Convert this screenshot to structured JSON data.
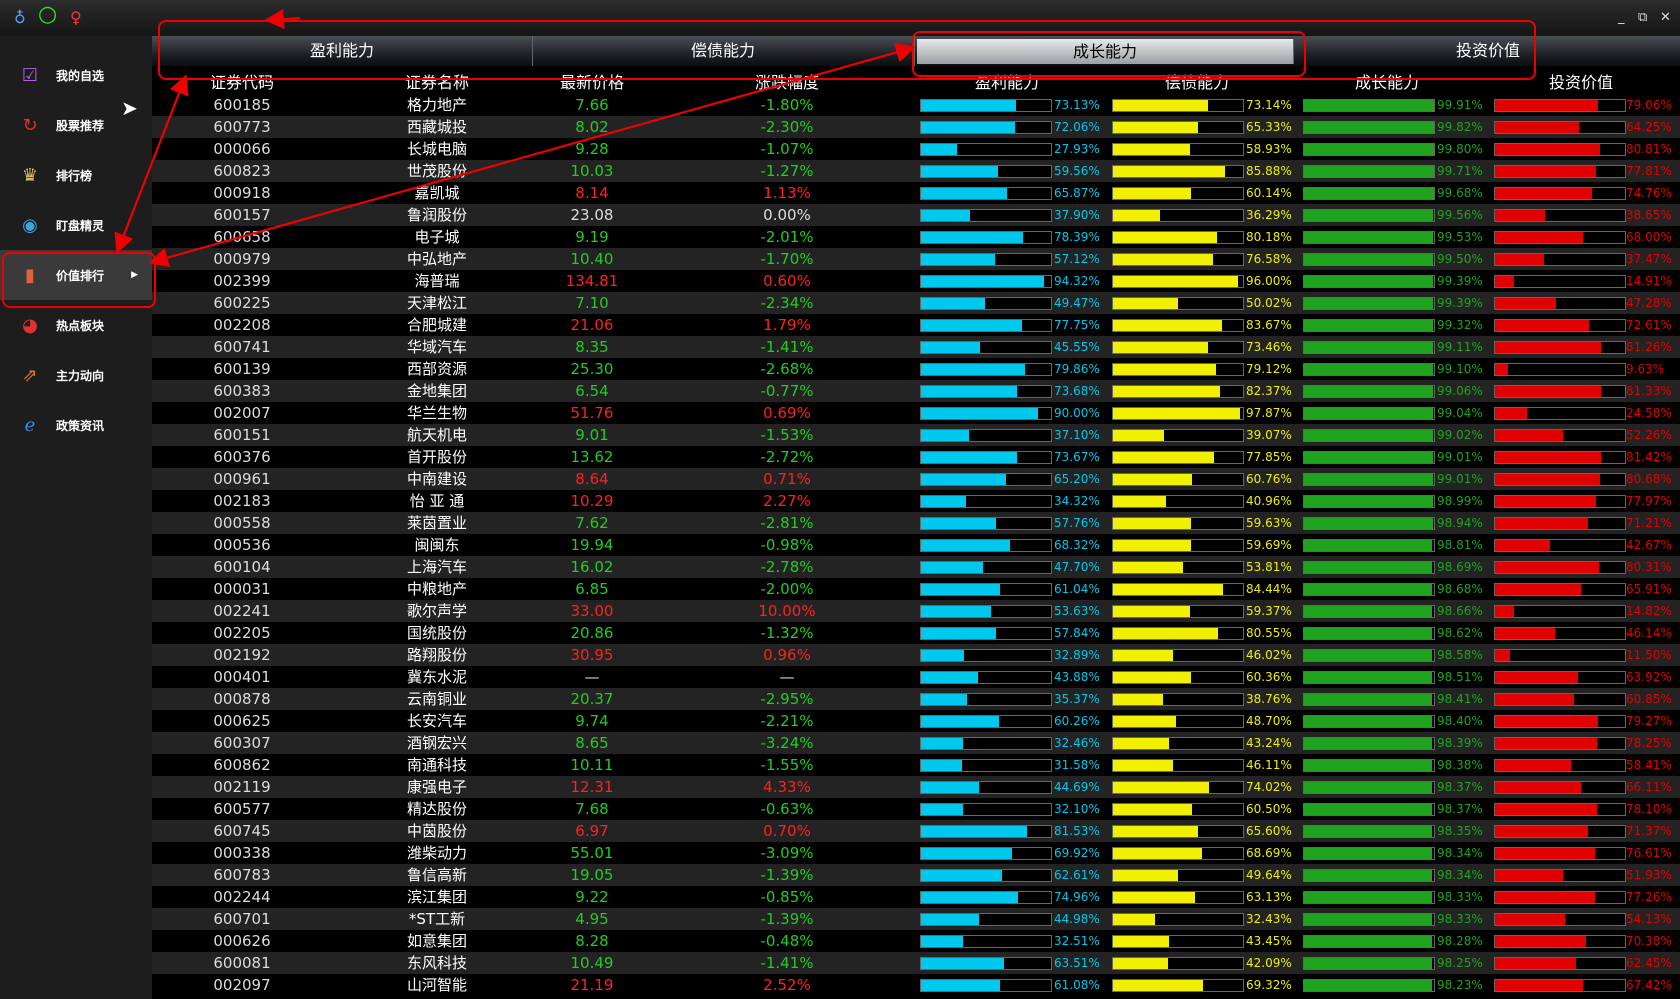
{
  "titlebar": {
    "icons": [
      "♁",
      "○",
      "♀"
    ],
    "controls": [
      "_",
      "⧉",
      "✕"
    ]
  },
  "sidebar": {
    "items": [
      {
        "label": "我的自选",
        "icon": "checkbox-icon",
        "glyph": "☑",
        "color": "#b060e0"
      },
      {
        "label": "股票推荐",
        "icon": "refresh-icon",
        "glyph": "↻",
        "color": "#e03030"
      },
      {
        "label": "排行榜",
        "icon": "trophy-icon",
        "glyph": "♛",
        "color": "#e0c060"
      },
      {
        "label": "盯盘精灵",
        "icon": "eye-icon",
        "glyph": "◉",
        "color": "#40a0e0"
      },
      {
        "label": "价值排行",
        "icon": "bar-chart-icon",
        "glyph": "▮",
        "color": "#e06040",
        "active": true
      },
      {
        "label": "热点板块",
        "icon": "pie-icon",
        "glyph": "◕",
        "color": "#e03030"
      },
      {
        "label": "主力动向",
        "icon": "trend-icon",
        "glyph": "⇗",
        "color": "#e08020"
      },
      {
        "label": "政策资讯",
        "icon": "browser-e-icon",
        "glyph": "ℯ",
        "color": "#3090e0"
      }
    ]
  },
  "tabs": [
    "盈利能力",
    "偿债能力",
    "成长能力",
    "投资价值"
  ],
  "active_tab": 2,
  "headers": [
    "证券代码",
    "证券名称",
    "最新价格",
    "涨跌幅度",
    "盈利能力",
    "偿债能力",
    "成长能力",
    "投资价值"
  ],
  "colors": {
    "profit": "#00c8ec",
    "debt": "#f0f000",
    "growth": "#1fa31f",
    "value": "#e00000",
    "up": "#ff2020",
    "down": "#22cc22"
  },
  "rows": [
    [
      "600185",
      "格力地产",
      "7.66",
      "-1.80%",
      73.13,
      73.14,
      99.91,
      79.06
    ],
    [
      "600773",
      "西藏城投",
      "8.02",
      "-2.30%",
      72.06,
      65.33,
      99.82,
      64.25
    ],
    [
      "000066",
      "长城电脑",
      "9.28",
      "-1.07%",
      27.93,
      58.93,
      99.8,
      80.81
    ],
    [
      "600823",
      "世茂股份",
      "10.03",
      "-1.27%",
      59.56,
      85.88,
      99.71,
      77.81
    ],
    [
      "000918",
      "嘉凯城",
      "8.14",
      "1.13%",
      65.87,
      60.14,
      99.68,
      74.76
    ],
    [
      "600157",
      "鲁润股份",
      "23.08",
      "0.00%",
      37.9,
      36.29,
      99.56,
      38.65
    ],
    [
      "600658",
      "电子城",
      "9.19",
      "-2.01%",
      78.39,
      80.18,
      99.53,
      68.0
    ],
    [
      "000979",
      "中弘地产",
      "10.40",
      "-1.70%",
      57.12,
      76.58,
      99.5,
      37.47
    ],
    [
      "002399",
      "海普瑞",
      "134.81",
      "0.60%",
      94.32,
      96.0,
      99.39,
      14.91
    ],
    [
      "600225",
      "天津松江",
      "7.10",
      "-2.34%",
      49.47,
      50.02,
      99.39,
      47.28
    ],
    [
      "002208",
      "合肥城建",
      "21.06",
      "1.79%",
      77.75,
      83.67,
      99.32,
      72.61
    ],
    [
      "600741",
      "华域汽车",
      "8.35",
      "-1.41%",
      45.55,
      73.46,
      99.11,
      81.26
    ],
    [
      "600139",
      "西部资源",
      "25.30",
      "-2.68%",
      79.86,
      79.12,
      99.1,
      9.63
    ],
    [
      "600383",
      "金地集团",
      "6.54",
      "-0.77%",
      73.68,
      82.37,
      99.06,
      81.33
    ],
    [
      "002007",
      "华兰生物",
      "51.76",
      "0.69%",
      90.0,
      97.87,
      99.04,
      24.58
    ],
    [
      "600151",
      "航天机电",
      "9.01",
      "-1.53%",
      37.1,
      39.07,
      99.02,
      52.26
    ],
    [
      "600376",
      "首开股份",
      "13.62",
      "-2.72%",
      73.67,
      77.85,
      99.01,
      81.42
    ],
    [
      "000961",
      "中南建设",
      "8.64",
      "0.71%",
      65.2,
      60.76,
      99.01,
      80.68
    ],
    [
      "002183",
      "怡 亚 通",
      "10.29",
      "2.27%",
      34.32,
      40.96,
      98.99,
      77.97
    ],
    [
      "000558",
      "莱茵置业",
      "7.62",
      "-2.81%",
      57.76,
      59.63,
      98.94,
      71.21
    ],
    [
      "000536",
      "闽闽东",
      "19.94",
      "-0.98%",
      68.32,
      59.69,
      98.81,
      42.67
    ],
    [
      "600104",
      "上海汽车",
      "16.02",
      "-2.78%",
      47.7,
      53.81,
      98.69,
      80.31
    ],
    [
      "000031",
      "中粮地产",
      "6.85",
      "-2.00%",
      61.04,
      84.44,
      98.68,
      65.91
    ],
    [
      "002241",
      "歌尔声学",
      "33.00",
      "10.00%",
      53.63,
      59.37,
      98.66,
      14.82
    ],
    [
      "002205",
      "国统股份",
      "20.86",
      "-1.32%",
      57.84,
      80.55,
      98.62,
      46.14
    ],
    [
      "002192",
      "路翔股份",
      "30.95",
      "0.96%",
      32.89,
      46.02,
      98.58,
      11.5
    ],
    [
      "000401",
      "冀东水泥",
      "—",
      "—",
      43.88,
      60.36,
      98.51,
      63.92
    ],
    [
      "000878",
      "云南铜业",
      "20.37",
      "-2.95%",
      35.37,
      38.76,
      98.41,
      60.85
    ],
    [
      "000625",
      "长安汽车",
      "9.74",
      "-2.21%",
      60.26,
      48.7,
      98.4,
      79.27
    ],
    [
      "600307",
      "酒钢宏兴",
      "8.65",
      "-3.24%",
      32.46,
      43.24,
      98.39,
      78.25
    ],
    [
      "600862",
      "南通科技",
      "10.11",
      "-1.55%",
      31.58,
      46.11,
      98.38,
      58.41
    ],
    [
      "002119",
      "康强电子",
      "12.31",
      "4.33%",
      44.69,
      74.02,
      98.37,
      66.11
    ],
    [
      "600577",
      "精达股份",
      "7.68",
      "-0.63%",
      32.1,
      60.5,
      98.37,
      78.1
    ],
    [
      "600745",
      "中茵股份",
      "6.97",
      "0.70%",
      81.53,
      65.6,
      98.35,
      71.37
    ],
    [
      "000338",
      "潍柴动力",
      "55.01",
      "-3.09%",
      69.92,
      68.69,
      98.34,
      76.61
    ],
    [
      "600783",
      "鲁信高新",
      "19.05",
      "-1.39%",
      62.61,
      49.64,
      98.34,
      51.93
    ],
    [
      "002244",
      "滨江集团",
      "9.22",
      "-0.85%",
      74.96,
      63.13,
      98.33,
      77.26
    ],
    [
      "600701",
      "*ST工新",
      "4.95",
      "-1.39%",
      44.98,
      32.43,
      98.33,
      54.13
    ],
    [
      "000626",
      "如意集团",
      "8.28",
      "-0.48%",
      32.51,
      43.45,
      98.28,
      70.38
    ],
    [
      "600081",
      "东风科技",
      "10.49",
      "-1.41%",
      63.51,
      42.09,
      98.25,
      62.45
    ],
    [
      "002097",
      "山河智能",
      "21.19",
      "2.52%",
      61.08,
      69.32,
      98.23,
      67.42
    ]
  ]
}
